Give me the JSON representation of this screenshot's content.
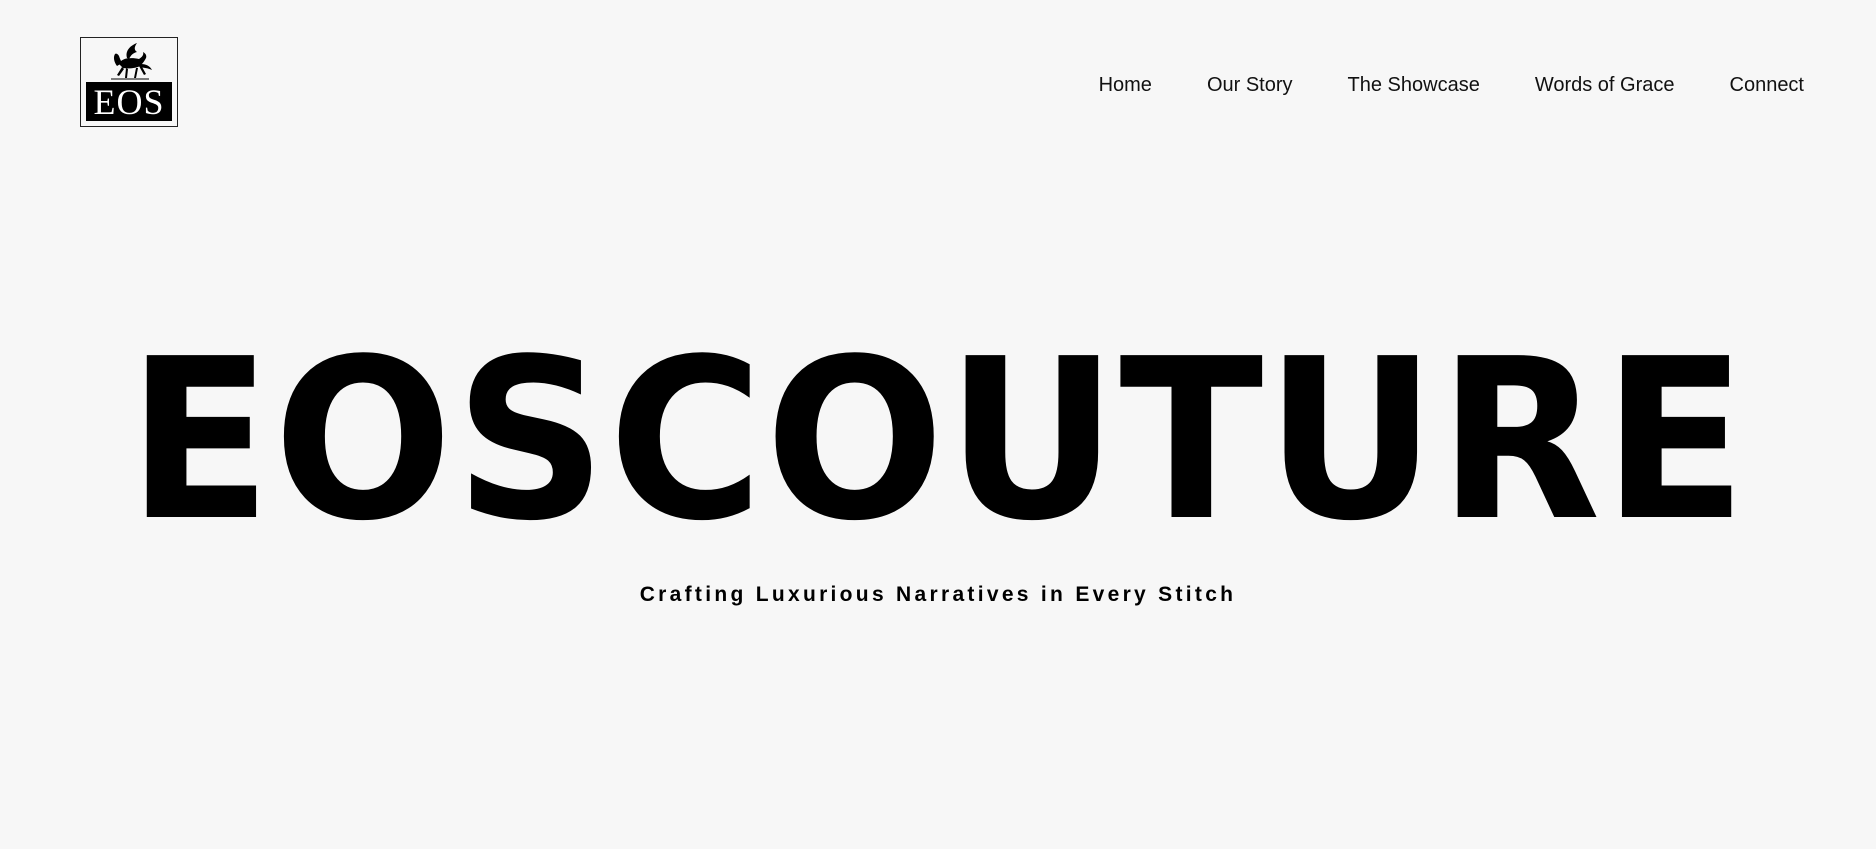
{
  "logo": {
    "text": "EOS",
    "icon": "pegasus-icon"
  },
  "nav": {
    "items": [
      {
        "label": "Home"
      },
      {
        "label": "Our Story"
      },
      {
        "label": "The Showcase"
      },
      {
        "label": "Words of Grace"
      },
      {
        "label": "Connect"
      }
    ]
  },
  "hero": {
    "title": "EOSCOUTURE",
    "subtitle": "Crafting Luxurious Narratives in Every Stitch"
  },
  "colors": {
    "background": "#f7f7f7",
    "text": "#000000"
  }
}
